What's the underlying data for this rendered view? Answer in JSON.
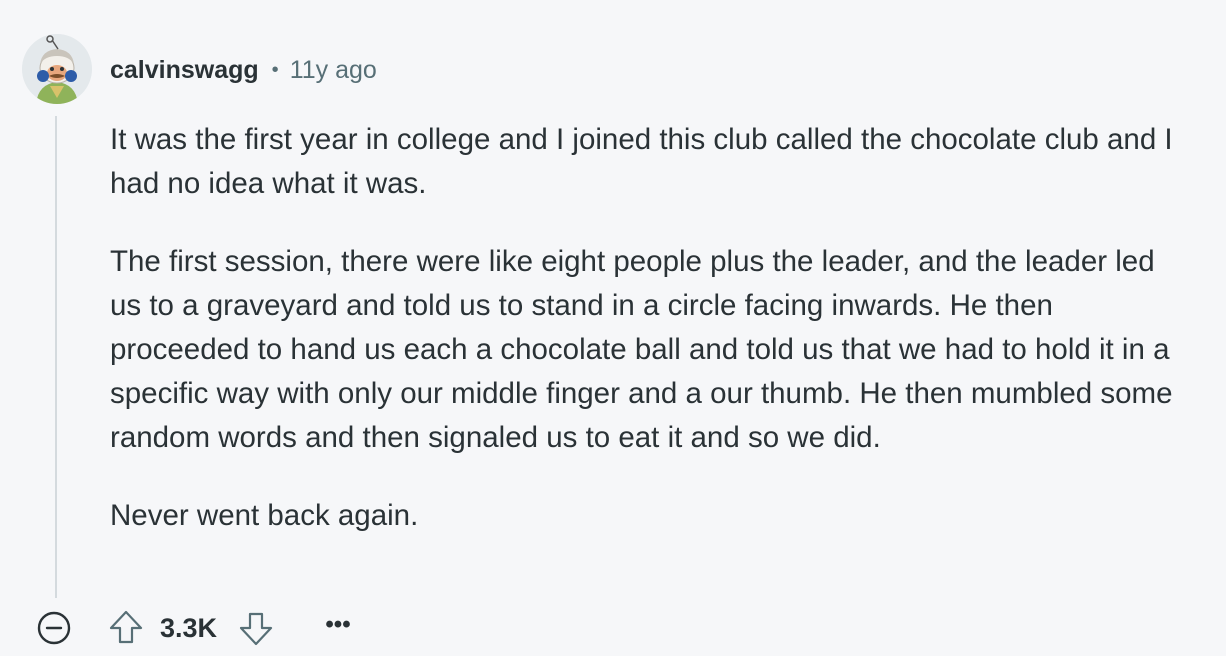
{
  "comment": {
    "username": "calvinswagg",
    "separator": "•",
    "time_ago": "11y ago",
    "paragraphs": [
      "It was the first year in college and I joined this club called the chocolate club and I had no idea what it was.",
      "The first session, there were like eight people plus the leader, and the leader led us to a graveyard and told us to stand in a circle facing inwards. He then proceeded to hand us each a chocolate ball and told us that we had to hold it in a specific way with only our middle finger and a our thumb. He then mumbled some random words and then signaled us to eat it and so we did.",
      "Never went back again."
    ]
  },
  "actions": {
    "score": "3.3K",
    "more": "•••",
    "collapse_icon": "minus-circle-icon",
    "upvote_icon": "arrow-up-icon",
    "downvote_icon": "arrow-down-icon"
  },
  "colors": {
    "background": "#f6f7f9",
    "text": "#2a3236",
    "muted": "#576f76",
    "thread_line": "#d4dade"
  }
}
